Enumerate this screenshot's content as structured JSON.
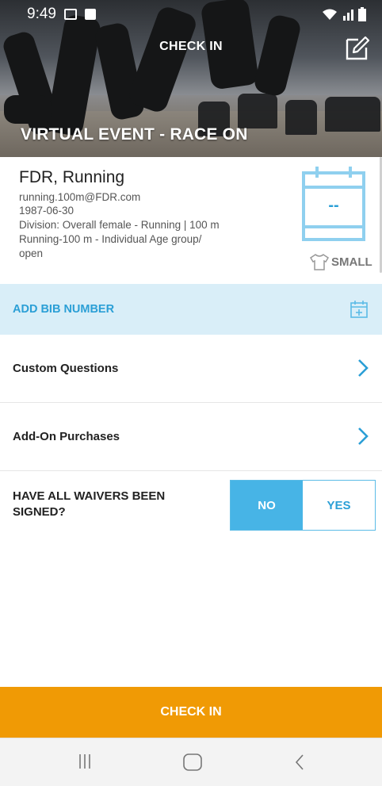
{
  "status": {
    "time": "9:49"
  },
  "header": {
    "title": "CHECK IN"
  },
  "event": {
    "title": "VIRTUAL EVENT - RACE ON"
  },
  "athlete": {
    "name": "FDR, Running",
    "email": "running.100m@FDR.com",
    "dob": "1987-06-30",
    "division": "Division: Overall female - Running | 100 m",
    "group_line1": "Running-100 m - Individual Age group/",
    "group_line2": "open",
    "bib_display": "--",
    "shirt_size": "SMALL"
  },
  "bib": {
    "label": "ADD BIB NUMBER"
  },
  "rows": {
    "custom_questions": "Custom Questions",
    "add_on_purchases": "Add-On Purchases"
  },
  "waiver": {
    "question": "HAVE ALL WAIVERS BEEN SIGNED?",
    "no": "NO",
    "yes": "YES",
    "selected": "NO"
  },
  "checkin_button": "CHECK IN",
  "colors": {
    "accent_blue": "#47b4e6",
    "bib_bg": "#d9eef8",
    "checkin_orange": "#f09a05"
  },
  "icons": [
    "gallery-icon",
    "close-box-icon",
    "wifi-icon",
    "signal-icon",
    "battery-icon",
    "edit-icon",
    "calendar-icon",
    "shirt-icon",
    "calendar-add-icon",
    "chevron-right-icon",
    "recent-apps-icon",
    "home-icon",
    "back-icon"
  ]
}
